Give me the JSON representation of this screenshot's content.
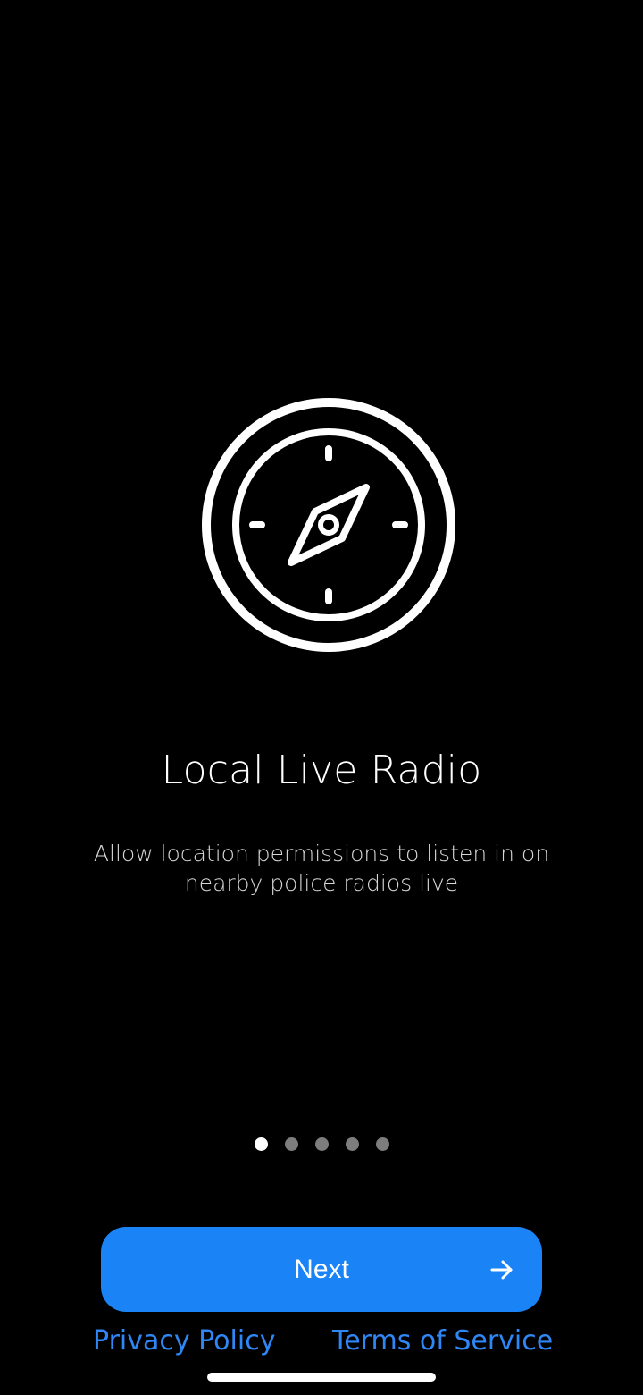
{
  "onboarding": {
    "icon": "compass-icon",
    "title": "Local Live Radio",
    "description": "Allow location permissions to listen in on nearby police radios live"
  },
  "pagination": {
    "total": 5,
    "current": 1
  },
  "next_button": {
    "label": "Next",
    "icon": "arrow-right-icon"
  },
  "footer": {
    "privacy_label": "Privacy Policy",
    "terms_label": "Terms of Service"
  },
  "colors": {
    "background": "#000000",
    "accent": "#1a84f7",
    "link": "#2f86f5",
    "dot_active": "#ffffff",
    "dot_inactive": "#7d7d7d"
  }
}
